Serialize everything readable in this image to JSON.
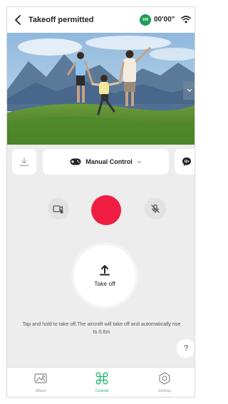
{
  "header": {
    "title": "Takeoff permitted",
    "battery_label": "100",
    "timer": "00'00\""
  },
  "control": {
    "mode_label": "Manual Control"
  },
  "takeoff": {
    "label": "Take off",
    "hint": "Tap and hold to take off.The aircraft will take off and automatically rise to 0.6m",
    "help_label": "?"
  },
  "nav": {
    "items": [
      {
        "label": "Album",
        "icon": "album-icon"
      },
      {
        "label": "Controls",
        "icon": "drone-icon",
        "active": true
      },
      {
        "label": "Settings",
        "icon": "settings-icon"
      }
    ]
  },
  "colors": {
    "record": "#ef1d42",
    "accent": "#1fb56e",
    "battery": "#1f9d57"
  }
}
